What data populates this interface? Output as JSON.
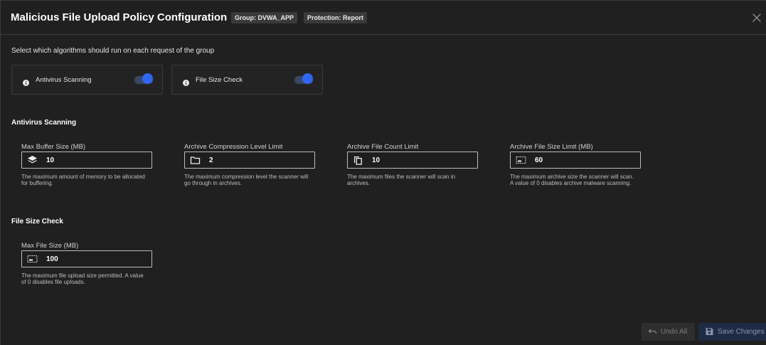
{
  "header": {
    "title": "Malicious File Upload Policy Configuration",
    "badges": [
      "Group: DVWA_APP",
      "Protection: Report"
    ]
  },
  "intro": "Select which algorithms should run on each request of the group",
  "algorithms": [
    {
      "label": "Antivirus Scanning",
      "enabled": true,
      "icon": "info-icon"
    },
    {
      "label": "File Size Check",
      "enabled": true,
      "icon": "info-icon"
    }
  ],
  "sections": {
    "antivirus": {
      "title": "Antivirus Scanning",
      "fields": [
        {
          "label": "Max Buffer Size (MB)",
          "value": "10",
          "icon": "layers-icon",
          "help": "The maximum amount of memory to be allocated for buffering."
        },
        {
          "label": "Archive Compression Level Limit",
          "value": "2",
          "icon": "folder-icon",
          "help": "The maximum compression level the scanner will go through in archives."
        },
        {
          "label": "Archive File Count Limit",
          "value": "10",
          "icon": "copy-icon",
          "help": "The maximum files the scanner will scan in archives."
        },
        {
          "label": "Archive File Size Limit (MB)",
          "value": "60",
          "icon": "file-size-icon",
          "help": "The maximum archive size the scanner will scan. A value of 0 disables archive malware scanning."
        }
      ]
    },
    "filesize": {
      "title": "File Size Check",
      "fields": [
        {
          "label": "Max File Size (MB)",
          "value": "100",
          "icon": "file-size-icon",
          "help": "The maximum file upload size permitted. A value of 0 disables file uploads."
        }
      ]
    }
  },
  "footer": {
    "undo_label": "Undo All",
    "save_label": "Save Changes"
  },
  "colors": {
    "background": "#202020",
    "accent": "#2f67f0",
    "save_button_bg": "#1f2b45",
    "undo_button_bg": "#2e2e2e"
  }
}
